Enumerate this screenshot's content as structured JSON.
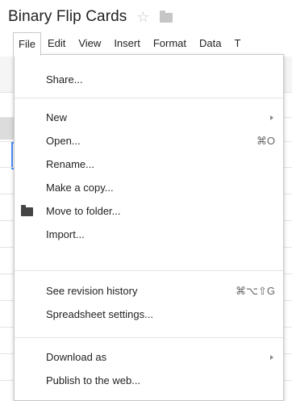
{
  "doc": {
    "title": "Binary Flip Cards"
  },
  "menubar": {
    "items": [
      {
        "label": "File"
      },
      {
        "label": "Edit"
      },
      {
        "label": "View"
      },
      {
        "label": "Insert"
      },
      {
        "label": "Format"
      },
      {
        "label": "Data"
      },
      {
        "label": "T"
      }
    ]
  },
  "file_menu": {
    "items": [
      {
        "label": "Share..."
      },
      {
        "label": "New"
      },
      {
        "label": "Open...",
        "shortcut": "⌘O"
      },
      {
        "label": "Rename..."
      },
      {
        "label": "Make a copy..."
      },
      {
        "label": "Move to folder..."
      },
      {
        "label": "Import..."
      },
      {
        "label": "See revision history",
        "shortcut": "⌘⌥⇧G"
      },
      {
        "label": "Spreadsheet settings..."
      },
      {
        "label": "Download as"
      },
      {
        "label": "Publish to the web..."
      }
    ]
  },
  "icons": {
    "star": "star-icon",
    "folder": "folder-icon",
    "submenu": "submenu-arrow-icon"
  },
  "colors": {
    "selection": "#4d90fe",
    "star": "#c8c8c8",
    "folder_title": "#c6c6c6",
    "folder_menu": "#444444"
  }
}
